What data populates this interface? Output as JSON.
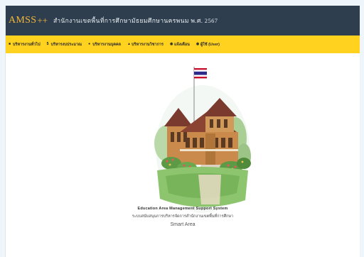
{
  "header": {
    "brand": "AMSS",
    "brand_suffix": "++",
    "org_name": "สำนักงานเขตพื้นที่การศึกษามัธยมศึกษานครพนม พ.ศ. 2567",
    "bg_color": "#2e3e4e",
    "brand_color": "#f3b83a"
  },
  "menu": {
    "bg_color": "#ffd21f",
    "items": [
      {
        "icon": "document-icon",
        "label": "บริหารงานทั่วไป"
      },
      {
        "icon": "money-icon",
        "label": "บริหารงบประมาณ"
      },
      {
        "icon": "person-icon",
        "label": "บริหารงานบุคคล"
      },
      {
        "icon": "graduation-cap-icon",
        "label": "บริหารงานวิชาการ"
      },
      {
        "icon": "info-icon",
        "label": "แจ้งเตือน"
      },
      {
        "icon": "user-circle-icon",
        "label": "ผู้ใช้ (User)"
      }
    ]
  },
  "main": {
    "caption_en": "Education Area Management Support System",
    "caption_th": "ระบบสนับสนุนการบริหารจัดการสำนักงานเขตพื้นที่การศึกษา",
    "tagline": "Smart Area"
  }
}
